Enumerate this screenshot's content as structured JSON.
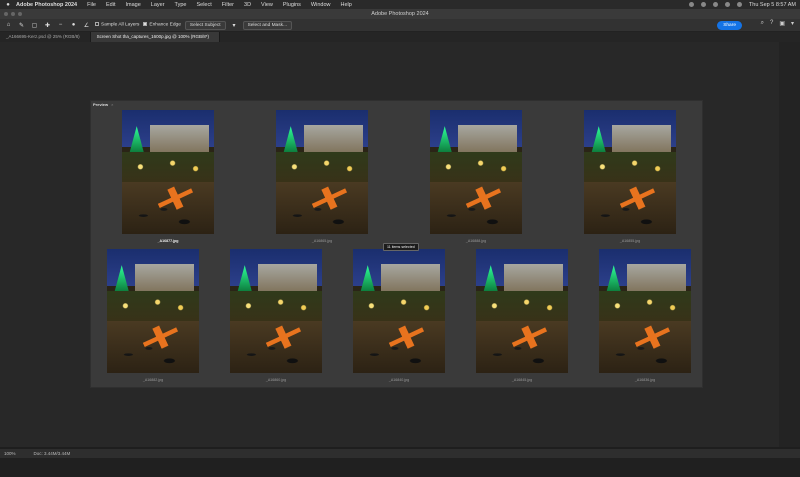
{
  "menubar": {
    "app_name": "Adobe Photoshop 2024",
    "items": [
      "File",
      "Edit",
      "Image",
      "Layer",
      "Type",
      "Select",
      "Filter",
      "3D",
      "View",
      "Plugins",
      "Window",
      "Help"
    ],
    "datetime": "Thu Sep 5  8:57 AM"
  },
  "window": {
    "title": "Adobe Photoshop 2024"
  },
  "options_bar": {
    "sample_all_layers": "Sample All Layers",
    "enhance_edge": "Enhance Edge",
    "select_subject": "Select Subject",
    "select_and_mask": "Select and Mask...",
    "share": "Share"
  },
  "tabs": [
    {
      "label": "_A166695-Kerz.psd @ 25% (RGB/8)"
    },
    {
      "label": "Screen Shot tha_captures_1600p.jpg @ 100% (RGB/8*)"
    }
  ],
  "document": {
    "tab_label": "Preview",
    "tab_close": "×",
    "thumbnails": [
      {
        "caption": "_A16877.jpg"
      },
      {
        "caption": "_A16865.jpg"
      },
      {
        "caption": "_A16888.jpg"
      },
      {
        "caption": "_A16855.jpg"
      },
      {
        "caption": "_A16882.jpg"
      },
      {
        "caption": "_A16860.jpg"
      },
      {
        "caption": "_A16840.jpg"
      },
      {
        "caption": "_A16845.jpg"
      },
      {
        "caption": "_A16836.jpg"
      }
    ],
    "selection_tooltip": "11 items selected"
  },
  "statusbar": {
    "zoom": "100%",
    "doc_size": "Doc: 3.44M/3.44M"
  }
}
